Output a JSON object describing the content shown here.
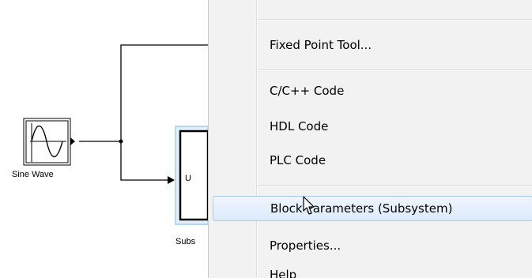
{
  "diagram": {
    "sine_block_label": "Sine Wave",
    "subsystem_port_label": "U",
    "subsystem_name_label": "Subs"
  },
  "context_menu": {
    "items": [
      {
        "label": "Fixed Point Tool..."
      },
      {
        "label": "C/C++ Code"
      },
      {
        "label": "HDL Code"
      },
      {
        "label": "PLC Code"
      },
      {
        "label": "Block Parameters (Subsystem)",
        "highlighted": true
      },
      {
        "label": "Properties..."
      },
      {
        "label": "Help"
      }
    ]
  },
  "colors": {
    "menu_background": "#f2f2f2",
    "highlight_border": "#a9c9ee",
    "subsystem_selection": "#b7d6f3"
  },
  "icons": [
    "sine-wave-icon",
    "arrow-cursor-icon"
  ]
}
